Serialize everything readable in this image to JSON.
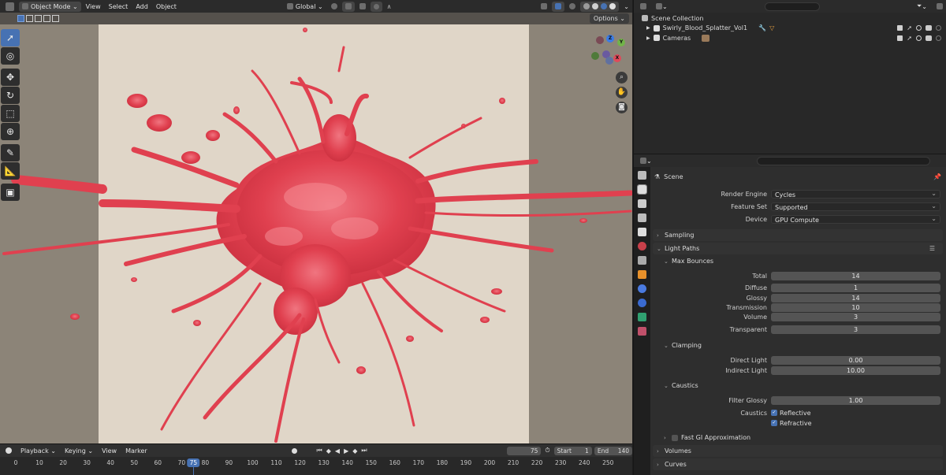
{
  "viewport": {
    "header": {
      "mode": "Object Mode",
      "menus": [
        "View",
        "Select",
        "Add",
        "Object"
      ],
      "orientation": "Global"
    },
    "options_label": "Options",
    "gizmo_axes": [
      "X",
      "Y",
      "Z"
    ]
  },
  "timeline": {
    "menus": [
      "Playback",
      "Keying",
      "View",
      "Marker"
    ],
    "current_frame": "75",
    "start_label": "Start",
    "start_value": "1",
    "end_label": "End",
    "end_value": "140",
    "ruler_ticks": [
      "0",
      "10",
      "20",
      "30",
      "40",
      "50",
      "60",
      "70",
      "80",
      "90",
      "100",
      "110",
      "120",
      "130",
      "140",
      "150",
      "160",
      "170",
      "180",
      "190",
      "200",
      "210",
      "220",
      "230",
      "240",
      "250"
    ]
  },
  "outliner": {
    "collection": "Scene Collection",
    "items": [
      {
        "label": "Swirly_Blood_Splatter_Vol1"
      },
      {
        "label": "Cameras"
      }
    ]
  },
  "properties": {
    "title": "Scene",
    "render_engine_label": "Render Engine",
    "render_engine": "Cycles",
    "feature_set_label": "Feature Set",
    "feature_set": "Supported",
    "device_label": "Device",
    "device": "GPU Compute",
    "sampling": "Sampling",
    "light_paths": "Light Paths",
    "max_bounces": "Max Bounces",
    "total_label": "Total",
    "total": "14",
    "diffuse_label": "Diffuse",
    "diffuse": "1",
    "glossy_label": "Glossy",
    "glossy": "14",
    "transmission_label": "Transmission",
    "transmission": "10",
    "volume_label": "Volume",
    "volume": "3",
    "transparent_label": "Transparent",
    "transparent": "3",
    "clamping": "Clamping",
    "direct_light_label": "Direct Light",
    "direct_light": "0.00",
    "indirect_light_label": "Indirect Light",
    "indirect_light": "10.00",
    "caustics": "Caustics",
    "filter_glossy_label": "Filter Glossy",
    "filter_glossy": "1.00",
    "caustics_label": "Caustics",
    "reflective": "Reflective",
    "refractive": "Refractive",
    "fast_gi": "Fast GI Approximation",
    "volumes": "Volumes",
    "curves": "Curves"
  },
  "colors": {
    "accent": "#4772b3",
    "splatter": "#e0404f",
    "background_plane": "#e0d6c8"
  }
}
